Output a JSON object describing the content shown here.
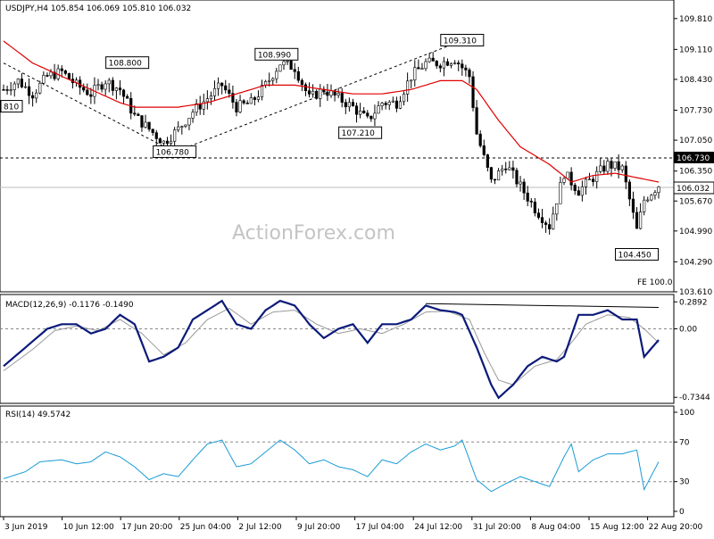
{
  "chart_data": [
    {
      "type": "candlestick",
      "title": "USDJPY,H4  105.854 106.069 105.810 106.032",
      "x_ticks": [
        "3 Jun 2019",
        "10 Jun 12:00",
        "17 Jun 20:00",
        "25 Jun 04:00",
        "2 Jul 12:00",
        "9 Jul 20:00",
        "17 Jul 04:00",
        "24 Jul 12:00",
        "31 Jul 20:00",
        "8 Aug 04:00",
        "15 Aug 12:00",
        "22 Aug 20:00"
      ],
      "y_ticks": [
        "109.810",
        "109.110",
        "108.430",
        "107.730",
        "107.050",
        "106.350",
        "105.670",
        "104.990",
        "104.290",
        "103.610"
      ],
      "ylim": [
        103.61,
        110.15
      ],
      "current_price": "106.032",
      "level_line": {
        "value": "106.730"
      },
      "annotations": [
        {
          "label": "108.800",
          "x": 34,
          "y": 108.8
        },
        {
          "label": "108.990",
          "x": 75,
          "y": 108.99
        },
        {
          "label": "109.310",
          "x": 126,
          "y": 109.31
        },
        {
          "label": "107.210",
          "x": 98,
          "y": 107.21
        },
        {
          "label": "106.780",
          "x": 47,
          "y": 106.78
        },
        {
          "label": "104.450",
          "x": 174,
          "y": 104.45
        },
        {
          "label": "810",
          "x": 0,
          "y": 107.81
        }
      ],
      "fe_label": "FE 100.0",
      "watermark": "ActionForex.com",
      "close_anchors": [
        [
          0,
          108.2
        ],
        [
          4,
          108.4
        ],
        [
          8,
          108.1
        ],
        [
          12,
          108.5
        ],
        [
          16,
          108.6
        ],
        [
          20,
          108.3
        ],
        [
          24,
          108.1
        ],
        [
          28,
          108.4
        ],
        [
          32,
          108.2
        ],
        [
          36,
          107.6
        ],
        [
          40,
          107.3
        ],
        [
          44,
          107.0
        ],
        [
          48,
          107.3
        ],
        [
          52,
          107.7
        ],
        [
          56,
          108.0
        ],
        [
          60,
          108.3
        ],
        [
          64,
          107.8
        ],
        [
          68,
          107.9
        ],
        [
          72,
          108.3
        ],
        [
          76,
          108.8
        ],
        [
          80,
          108.7
        ],
        [
          84,
          108.0
        ],
        [
          88,
          108.2
        ],
        [
          92,
          108.0
        ],
        [
          96,
          107.8
        ],
        [
          100,
          107.5
        ],
        [
          104,
          107.9
        ],
        [
          108,
          107.9
        ],
        [
          112,
          108.5
        ],
        [
          116,
          108.8
        ],
        [
          120,
          108.8
        ],
        [
          124,
          108.9
        ],
        [
          128,
          108.5
        ],
        [
          130,
          107.2
        ],
        [
          134,
          106.1
        ],
        [
          138,
          106.5
        ],
        [
          142,
          106.0
        ],
        [
          146,
          105.5
        ],
        [
          150,
          105.1
        ],
        [
          154,
          106.3
        ],
        [
          158,
          105.9
        ],
        [
          162,
          106.2
        ],
        [
          166,
          106.5
        ],
        [
          170,
          106.4
        ],
        [
          174,
          105.0
        ],
        [
          176,
          105.7
        ],
        [
          180,
          106.03
        ]
      ],
      "ma_anchors": [
        [
          0,
          109.3
        ],
        [
          8,
          108.8
        ],
        [
          16,
          108.5
        ],
        [
          24,
          108.2
        ],
        [
          32,
          107.9
        ],
        [
          36,
          107.8
        ],
        [
          40,
          107.8
        ],
        [
          48,
          107.8
        ],
        [
          56,
          107.9
        ],
        [
          64,
          108.1
        ],
        [
          72,
          108.3
        ],
        [
          80,
          108.3
        ],
        [
          88,
          108.2
        ],
        [
          96,
          108.1
        ],
        [
          104,
          108.1
        ],
        [
          112,
          108.2
        ],
        [
          120,
          108.4
        ],
        [
          126,
          108.4
        ],
        [
          130,
          108.2
        ],
        [
          136,
          107.5
        ],
        [
          142,
          106.9
        ],
        [
          150,
          106.5
        ],
        [
          156,
          106.1
        ],
        [
          162,
          106.25
        ],
        [
          168,
          106.3
        ],
        [
          174,
          106.2
        ],
        [
          180,
          106.1
        ]
      ],
      "dashed_trendlines": [
        [
          [
            0,
            108.8
          ],
          [
            47,
            106.78
          ]
        ],
        [
          [
            47,
            106.78
          ],
          [
            126,
            109.31
          ]
        ]
      ]
    },
    {
      "type": "line",
      "title": "MACD(12,26,9) -0.1176 -0.1490",
      "y_ticks": [
        "0.2892",
        "0.00",
        "-0.7344"
      ],
      "ylim": [
        -0.78,
        0.33
      ],
      "series_anchors": [
        [
          0,
          -0.4
        ],
        [
          6,
          -0.2
        ],
        [
          12,
          0.0
        ],
        [
          16,
          0.05
        ],
        [
          20,
          0.05
        ],
        [
          24,
          -0.05
        ],
        [
          28,
          0.0
        ],
        [
          32,
          0.15
        ],
        [
          36,
          0.05
        ],
        [
          40,
          -0.35
        ],
        [
          44,
          -0.3
        ],
        [
          48,
          -0.2
        ],
        [
          52,
          0.1
        ],
        [
          56,
          0.2
        ],
        [
          60,
          0.3
        ],
        [
          64,
          0.05
        ],
        [
          68,
          0.0
        ],
        [
          72,
          0.2
        ],
        [
          76,
          0.3
        ],
        [
          80,
          0.25
        ],
        [
          84,
          0.05
        ],
        [
          88,
          -0.1
        ],
        [
          92,
          0.0
        ],
        [
          96,
          0.05
        ],
        [
          100,
          -0.15
        ],
        [
          104,
          0.05
        ],
        [
          108,
          0.05
        ],
        [
          112,
          0.1
        ],
        [
          116,
          0.25
        ],
        [
          120,
          0.2
        ],
        [
          124,
          0.18
        ],
        [
          126,
          0.15
        ],
        [
          130,
          -0.2
        ],
        [
          134,
          -0.6
        ],
        [
          136,
          -0.74
        ],
        [
          140,
          -0.6
        ],
        [
          144,
          -0.4
        ],
        [
          148,
          -0.3
        ],
        [
          152,
          -0.35
        ],
        [
          154,
          -0.3
        ],
        [
          158,
          0.15
        ],
        [
          162,
          0.15
        ],
        [
          166,
          0.2
        ],
        [
          170,
          0.1
        ],
        [
          174,
          0.1
        ],
        [
          176,
          -0.3
        ],
        [
          180,
          -0.12
        ]
      ],
      "signal_anchors": [
        [
          0,
          -0.45
        ],
        [
          8,
          -0.22
        ],
        [
          14,
          -0.02
        ],
        [
          20,
          0.03
        ],
        [
          26,
          -0.02
        ],
        [
          32,
          0.1
        ],
        [
          38,
          -0.05
        ],
        [
          44,
          -0.28
        ],
        [
          50,
          -0.15
        ],
        [
          56,
          0.1
        ],
        [
          62,
          0.22
        ],
        [
          68,
          0.05
        ],
        [
          74,
          0.18
        ],
        [
          80,
          0.2
        ],
        [
          86,
          0.05
        ],
        [
          92,
          -0.05
        ],
        [
          98,
          0.0
        ],
        [
          104,
          -0.05
        ],
        [
          110,
          0.05
        ],
        [
          116,
          0.18
        ],
        [
          122,
          0.19
        ],
        [
          128,
          0.1
        ],
        [
          132,
          -0.25
        ],
        [
          136,
          -0.55
        ],
        [
          140,
          -0.6
        ],
        [
          146,
          -0.4
        ],
        [
          152,
          -0.33
        ],
        [
          156,
          -0.15
        ],
        [
          160,
          0.05
        ],
        [
          166,
          0.15
        ],
        [
          172,
          0.12
        ],
        [
          176,
          0.0
        ],
        [
          180,
          -0.15
        ]
      ],
      "trendline": [
        [
          116,
          0.27
        ],
        [
          180,
          0.23
        ]
      ]
    },
    {
      "type": "line",
      "title": "RSI(14) 49.5742",
      "y_ticks": [
        "100",
        "70",
        "30",
        "0"
      ],
      "levels": [
        70,
        30
      ],
      "ylim": [
        0,
        100
      ],
      "series_anchors": [
        [
          0,
          33
        ],
        [
          6,
          40
        ],
        [
          10,
          50
        ],
        [
          16,
          52
        ],
        [
          20,
          48
        ],
        [
          24,
          50
        ],
        [
          28,
          60
        ],
        [
          32,
          55
        ],
        [
          36,
          45
        ],
        [
          40,
          32
        ],
        [
          44,
          38
        ],
        [
          48,
          35
        ],
        [
          52,
          52
        ],
        [
          56,
          68
        ],
        [
          60,
          72
        ],
        [
          64,
          45
        ],
        [
          68,
          48
        ],
        [
          72,
          60
        ],
        [
          76,
          72
        ],
        [
          80,
          62
        ],
        [
          84,
          48
        ],
        [
          88,
          52
        ],
        [
          92,
          45
        ],
        [
          96,
          42
        ],
        [
          100,
          35
        ],
        [
          104,
          52
        ],
        [
          108,
          48
        ],
        [
          112,
          60
        ],
        [
          116,
          68
        ],
        [
          120,
          62
        ],
        [
          124,
          66
        ],
        [
          126,
          72
        ],
        [
          130,
          32
        ],
        [
          134,
          20
        ],
        [
          138,
          28
        ],
        [
          142,
          35
        ],
        [
          146,
          30
        ],
        [
          150,
          25
        ],
        [
          154,
          55
        ],
        [
          156,
          68
        ],
        [
          158,
          40
        ],
        [
          162,
          52
        ],
        [
          166,
          58
        ],
        [
          170,
          58
        ],
        [
          174,
          62
        ],
        [
          176,
          22
        ],
        [
          180,
          50
        ]
      ]
    }
  ]
}
